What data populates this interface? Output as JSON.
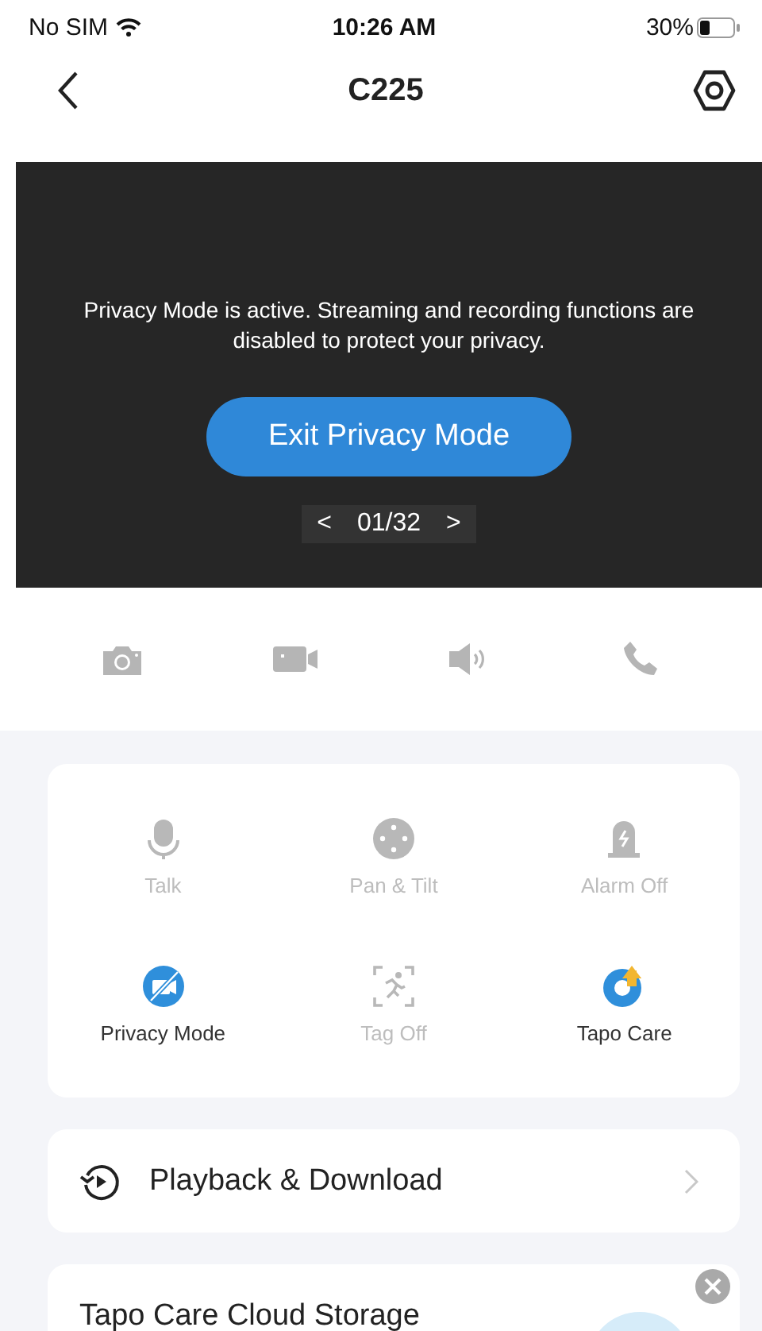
{
  "status_bar": {
    "carrier": "No SIM",
    "time": "10:26 AM",
    "battery": "30%"
  },
  "nav": {
    "title": "C225"
  },
  "video": {
    "message": "Privacy Mode is active. Streaming and recording functions are disabled to protect your privacy.",
    "button": "Exit Privacy Mode",
    "prev": "<",
    "counter": "01/32",
    "next": ">"
  },
  "toolbar": [
    {
      "kind": "snapshot",
      "disabled": true
    },
    {
      "kind": "record",
      "disabled": true
    },
    {
      "kind": "speaker",
      "disabled": true
    },
    {
      "kind": "call",
      "disabled": true
    }
  ],
  "controls": [
    {
      "kind": "talk",
      "label": "Talk",
      "disabled": true
    },
    {
      "kind": "pan",
      "label": "Pan & Tilt",
      "disabled": true
    },
    {
      "kind": "alarm",
      "label": "Alarm Off",
      "disabled": true
    },
    {
      "kind": "privacy",
      "label": "Privacy Mode",
      "disabled": false
    },
    {
      "kind": "tag",
      "label": "Tag Off",
      "disabled": true
    },
    {
      "kind": "care",
      "label": "Tapo Care",
      "disabled": false
    }
  ],
  "playback": {
    "label": "Playback & Download"
  },
  "promo": {
    "title": "Tapo Care Cloud Storage"
  }
}
